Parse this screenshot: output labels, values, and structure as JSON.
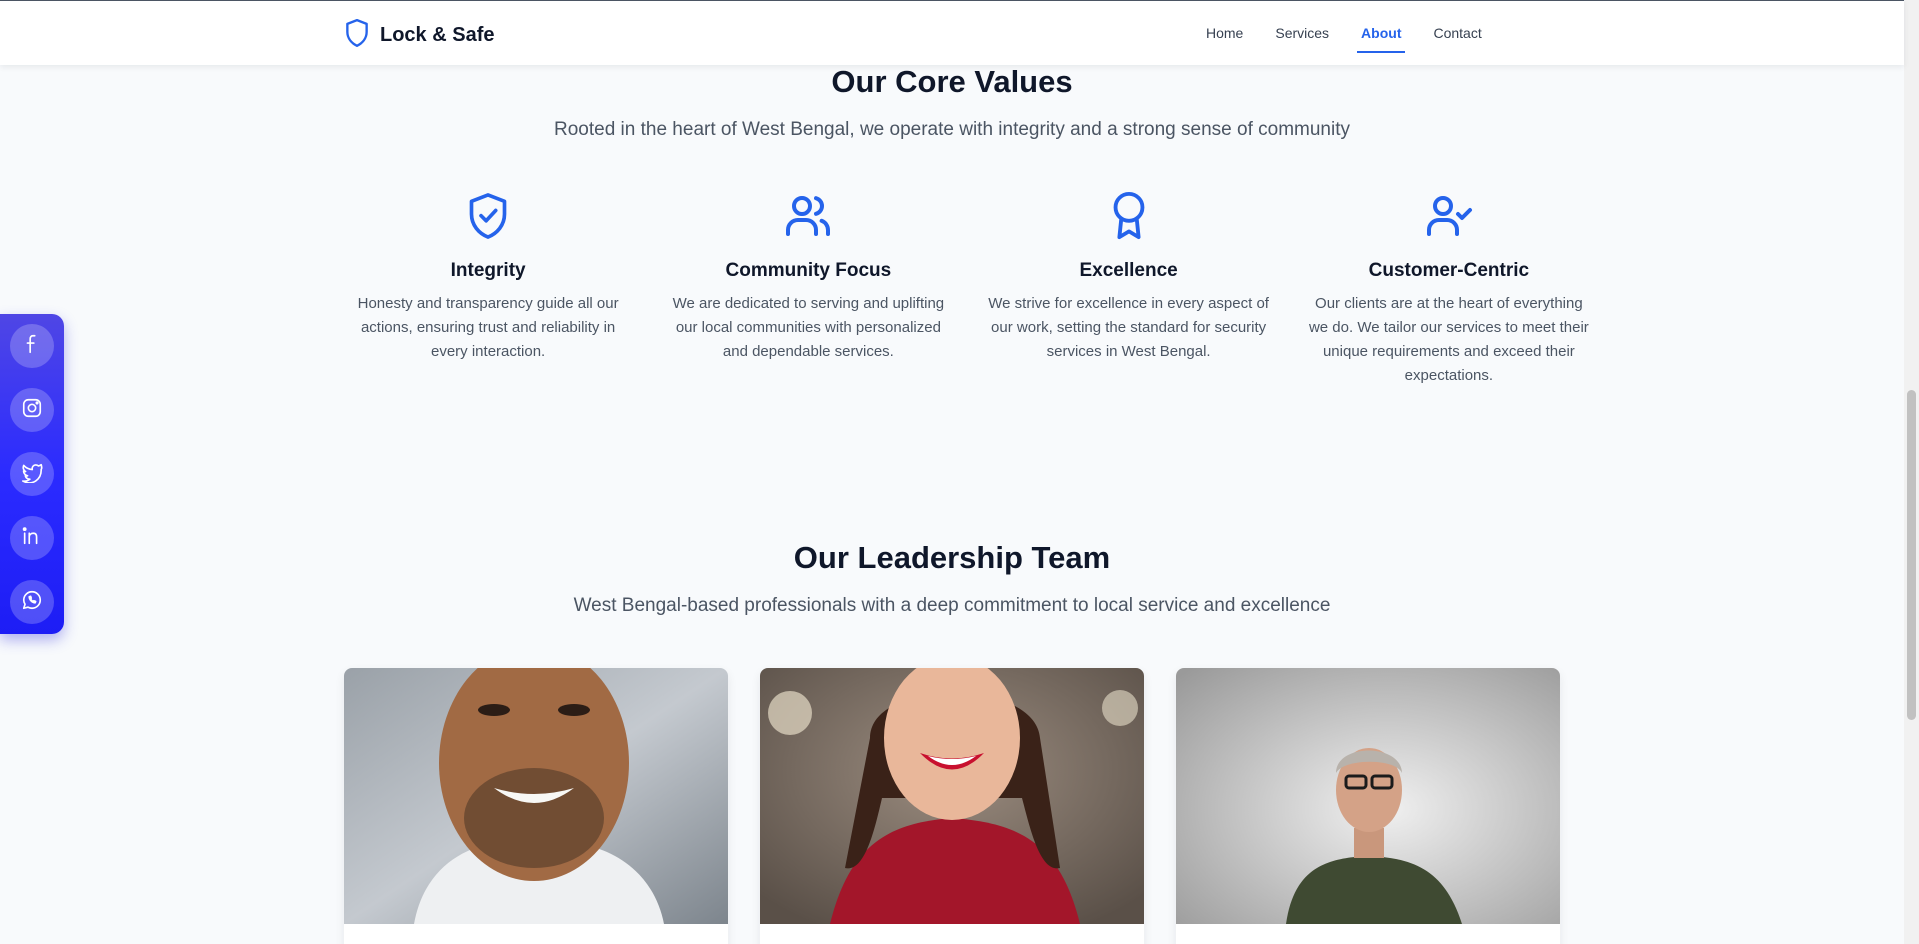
{
  "header": {
    "brand": "Lock & Safe",
    "nav": [
      "Home",
      "Services",
      "About",
      "Contact"
    ],
    "active_nav": "About"
  },
  "values": {
    "title": "Our Core Values",
    "subtitle": "Rooted in the heart of West Bengal, we operate with integrity and a strong sense of community",
    "items": [
      {
        "icon": "shield-check-icon",
        "title": "Integrity",
        "desc": "Honesty and transparency guide all our actions, ensuring trust and reliability in every interaction."
      },
      {
        "icon": "users-icon",
        "title": "Community Focus",
        "desc": "We are dedicated to serving and uplifting our local communities with personalized and dependable services."
      },
      {
        "icon": "award-icon",
        "title": "Excellence",
        "desc": "We strive for excellence in every aspect of our work, setting the standard for security services in West Bengal."
      },
      {
        "icon": "user-check-icon",
        "title": "Customer-Centric",
        "desc": "Our clients are at the heart of everything we do. We tailor our services to meet their unique requirements and exceed their expectations."
      }
    ]
  },
  "team": {
    "title": "Our Leadership Team",
    "subtitle": "West Bengal-based professionals with a deep commitment to local service and excellence"
  },
  "social": [
    "facebook-icon",
    "instagram-icon",
    "twitter-icon",
    "linkedin-icon",
    "whatsapp-icon"
  ],
  "colors": {
    "accent": "#2563eb",
    "social_bar": "#2b2bff",
    "background": "#f8fafc"
  }
}
